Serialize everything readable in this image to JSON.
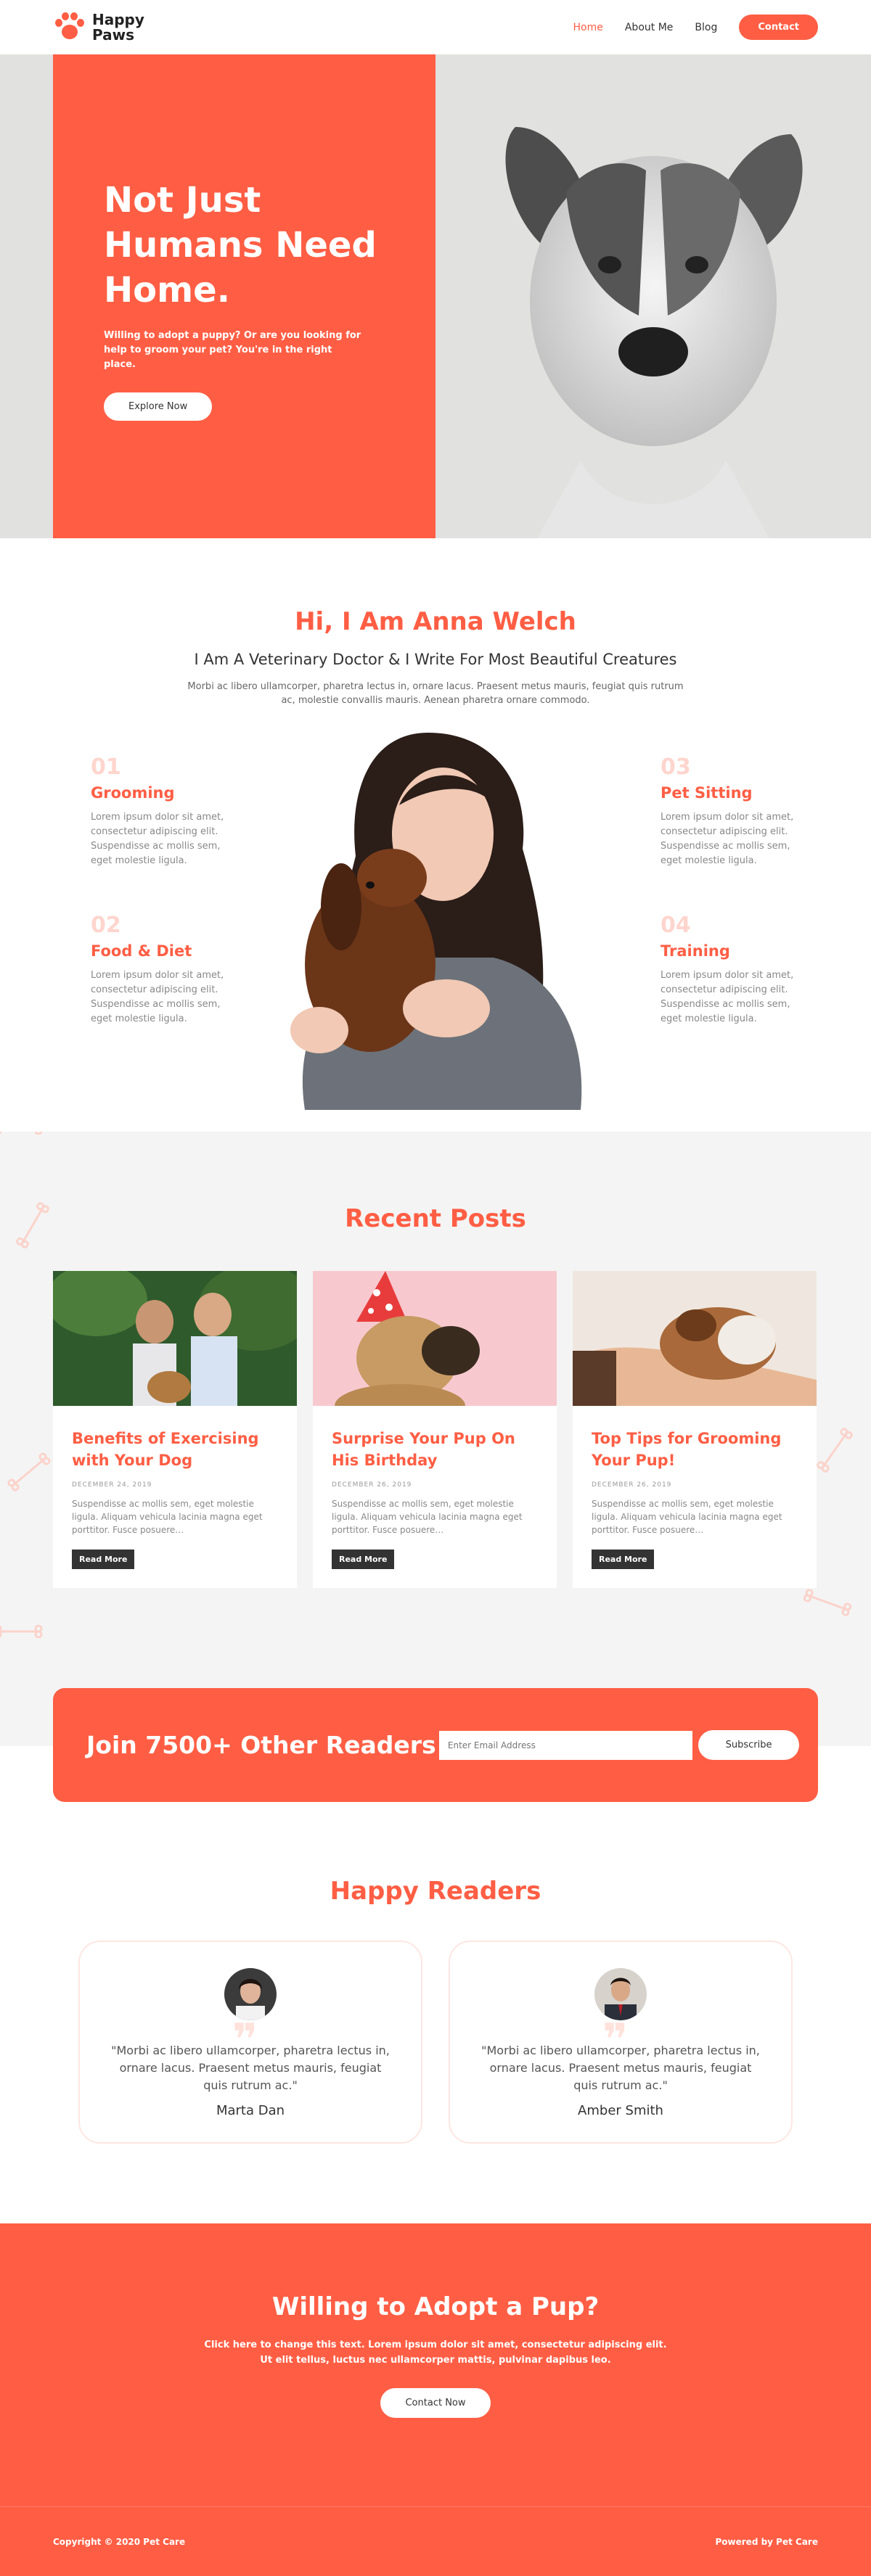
{
  "header": {
    "logo_line1": "Happy",
    "logo_line2": "Paws",
    "nav": [
      {
        "label": "Home"
      },
      {
        "label": "About Me"
      },
      {
        "label": "Blog"
      }
    ],
    "contact_label": "Contact"
  },
  "hero": {
    "title": "Not Just Humans Need Home.",
    "subtitle": "Willing to adopt a puppy? Or are you looking for help to groom your pet? You're in the right place.",
    "button": "Explore Now"
  },
  "about": {
    "title": "Hi, I Am Anna Welch",
    "subtitle": "I Am A Veterinary Doctor & I Write For Most Beautiful Creatures",
    "paragraph": "Morbi ac libero ullamcorper, pharetra lectus in, ornare lacus. Praesent metus mauris, feugiat quis rutrum ac, molestie convallis mauris. Aenean pharetra ornare commodo.",
    "services": [
      {
        "num": "01",
        "title": "Grooming",
        "text": "Lorem ipsum dolor sit amet, consectetur adipiscing elit. Suspendisse ac mollis sem, eget molestie ligula."
      },
      {
        "num": "02",
        "title": "Food & Diet",
        "text": "Lorem ipsum dolor sit amet, consectetur adipiscing elit. Suspendisse ac mollis sem, eget molestie ligula."
      },
      {
        "num": "03",
        "title": "Pet Sitting",
        "text": "Lorem ipsum dolor sit amet, consectetur adipiscing elit. Suspendisse ac mollis sem, eget molestie ligula."
      },
      {
        "num": "04",
        "title": "Training",
        "text": "Lorem ipsum dolor sit amet, consectetur adipiscing elit. Suspendisse ac mollis sem, eget molestie ligula."
      }
    ]
  },
  "posts": {
    "title": "Recent Posts",
    "items": [
      {
        "title": "Benefits of Exercising with Your Dog",
        "date": "DECEMBER 24, 2019",
        "text": "Suspendisse ac mollis sem, eget molestie ligula. Aliquam vehicula lacinia magna eget porttitor. Fusce posuere…",
        "button": "Read More"
      },
      {
        "title": "Surprise Your Pup On His Birthday",
        "date": "DECEMBER 26, 2019",
        "text": "Suspendisse ac mollis sem, eget molestie ligula. Aliquam vehicula lacinia magna eget porttitor. Fusce posuere…",
        "button": "Read More"
      },
      {
        "title": "Top Tips for Grooming Your Pup!",
        "date": "DECEMBER 26, 2019",
        "text": "Suspendisse ac mollis sem, eget molestie ligula. Aliquam vehicula lacinia magna eget porttitor. Fusce posuere…",
        "button": "Read More"
      }
    ]
  },
  "subscribe": {
    "title": "Join 7500+ Other Readers",
    "placeholder": "Enter Email Address",
    "button": "Subscribe"
  },
  "readers": {
    "title": "Happy Readers",
    "items": [
      {
        "quote": "\"Morbi ac libero ullamcorper, pharetra lectus in, ornare lacus. Praesent metus mauris, feugiat quis rutrum ac.\"",
        "name": "Marta Dan"
      },
      {
        "quote": "\"Morbi ac libero ullamcorper, pharetra lectus in, ornare lacus. Praesent metus mauris, feugiat quis rutrum ac.\"",
        "name": "Amber Smith"
      }
    ]
  },
  "cta": {
    "title": "Willing to Adopt a Pup?",
    "text": "Click here to change this text. Lorem ipsum dolor sit amet, consectetur adipiscing elit. Ut elit tellus, luctus nec ullamcorper mattis, pulvinar dapibus leo.",
    "button": "Contact Now"
  },
  "footer": {
    "copyright": "Copyright © 2020 Pet Care",
    "powered": "Powered by Pet Care"
  },
  "colors": {
    "accent": "#ff5e44",
    "dark": "#333333",
    "light_bg": "#f4f4f4"
  }
}
